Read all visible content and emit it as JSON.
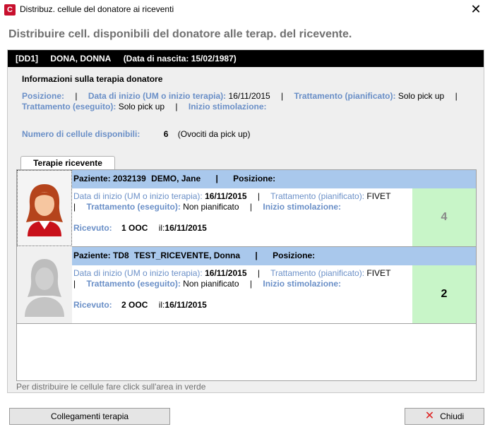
{
  "window": {
    "title": "Distribuz. cellule del donatore ai riceventi",
    "app_icon": "C",
    "close_glyph": "✕"
  },
  "heading": "Distribuire cell. disponibili del donatore alle terap. del ricevente.",
  "donor": {
    "code": "[DD1]",
    "name": "DONA, DONNA",
    "birth": "(Data di nascita: 15/02/1987)"
  },
  "info": {
    "title": "Informazioni sulla terapia donatore",
    "posizione_label": "Posizione:",
    "data_inizio_label": "Data di inizio (UM o inizio terapia):",
    "data_inizio_value": "16/11/2015",
    "tratt_pian_label": "Trattamento (pianificato):",
    "tratt_pian_value": "Solo pick up",
    "tratt_eseg_label": "Trattamento (eseguito):",
    "tratt_eseg_value": "Solo pick up",
    "stim_label": "Inizio stimolazione:",
    "cells_label": "Numero di cellule disponibili:",
    "cells_value": "6",
    "cells_note": "(Ovociti da pick up)"
  },
  "tab": {
    "label": "Terapie ricevente"
  },
  "recipients": [
    {
      "patient_label": "Paziente:",
      "patient_id": "2032139",
      "patient_name": "DEMO, Jane",
      "posizione_label": "Posizione:",
      "data_inizio_label": "Data di inizio (UM o inizio terapia):",
      "data_inizio_value": "16/11/2015",
      "tratt_pian_label": "Trattamento (pianificato):",
      "tratt_pian_value": "FIVET",
      "tratt_eseg_label": "Trattamento (eseguito):",
      "tratt_eseg_value": "Non pianificato",
      "stim_label": "Inizio stimolazione:",
      "ricevuto_label": "Ricevuto:",
      "ricevuto_value": "1 OOC",
      "il_label": "il:",
      "il_value": "16/11/2015",
      "count": "4"
    },
    {
      "patient_label": "Paziente:",
      "patient_id": "TD8",
      "patient_name": "TEST_RICEVENTE, Donna",
      "posizione_label": "Posizione:",
      "data_inizio_label": "Data di inizio (UM o inizio terapia):",
      "data_inizio_value": "16/11/2015",
      "tratt_pian_label": "Trattamento (pianificato):",
      "tratt_pian_value": "FIVET",
      "tratt_eseg_label": "Trattamento (eseguito):",
      "tratt_eseg_value": "Non pianificato",
      "stim_label": "Inizio stimolazione:",
      "ricevuto_label": "Ricevuto:",
      "ricevuto_value": "2 OOC",
      "il_label": "il:",
      "il_value": "16/11/2015",
      "count": "2"
    }
  ],
  "hint": "Per distribuire le cellule fare click sull'area in verde",
  "buttons": {
    "links_label": "Collegamenti terapia",
    "close_label": "Chiudi",
    "close_icon_glyph": "✕"
  },
  "colors": {
    "label_blue": "#6a8fc7",
    "header_blue": "#a9c8ec",
    "green_area": "#c8f5c8",
    "donor_bar": "#000000"
  },
  "icons": {
    "app": "app-logo-icon",
    "recipient1": "female-avatar-icon",
    "recipient2": "person-silhouette-icon",
    "close_button": "red-x-icon"
  }
}
